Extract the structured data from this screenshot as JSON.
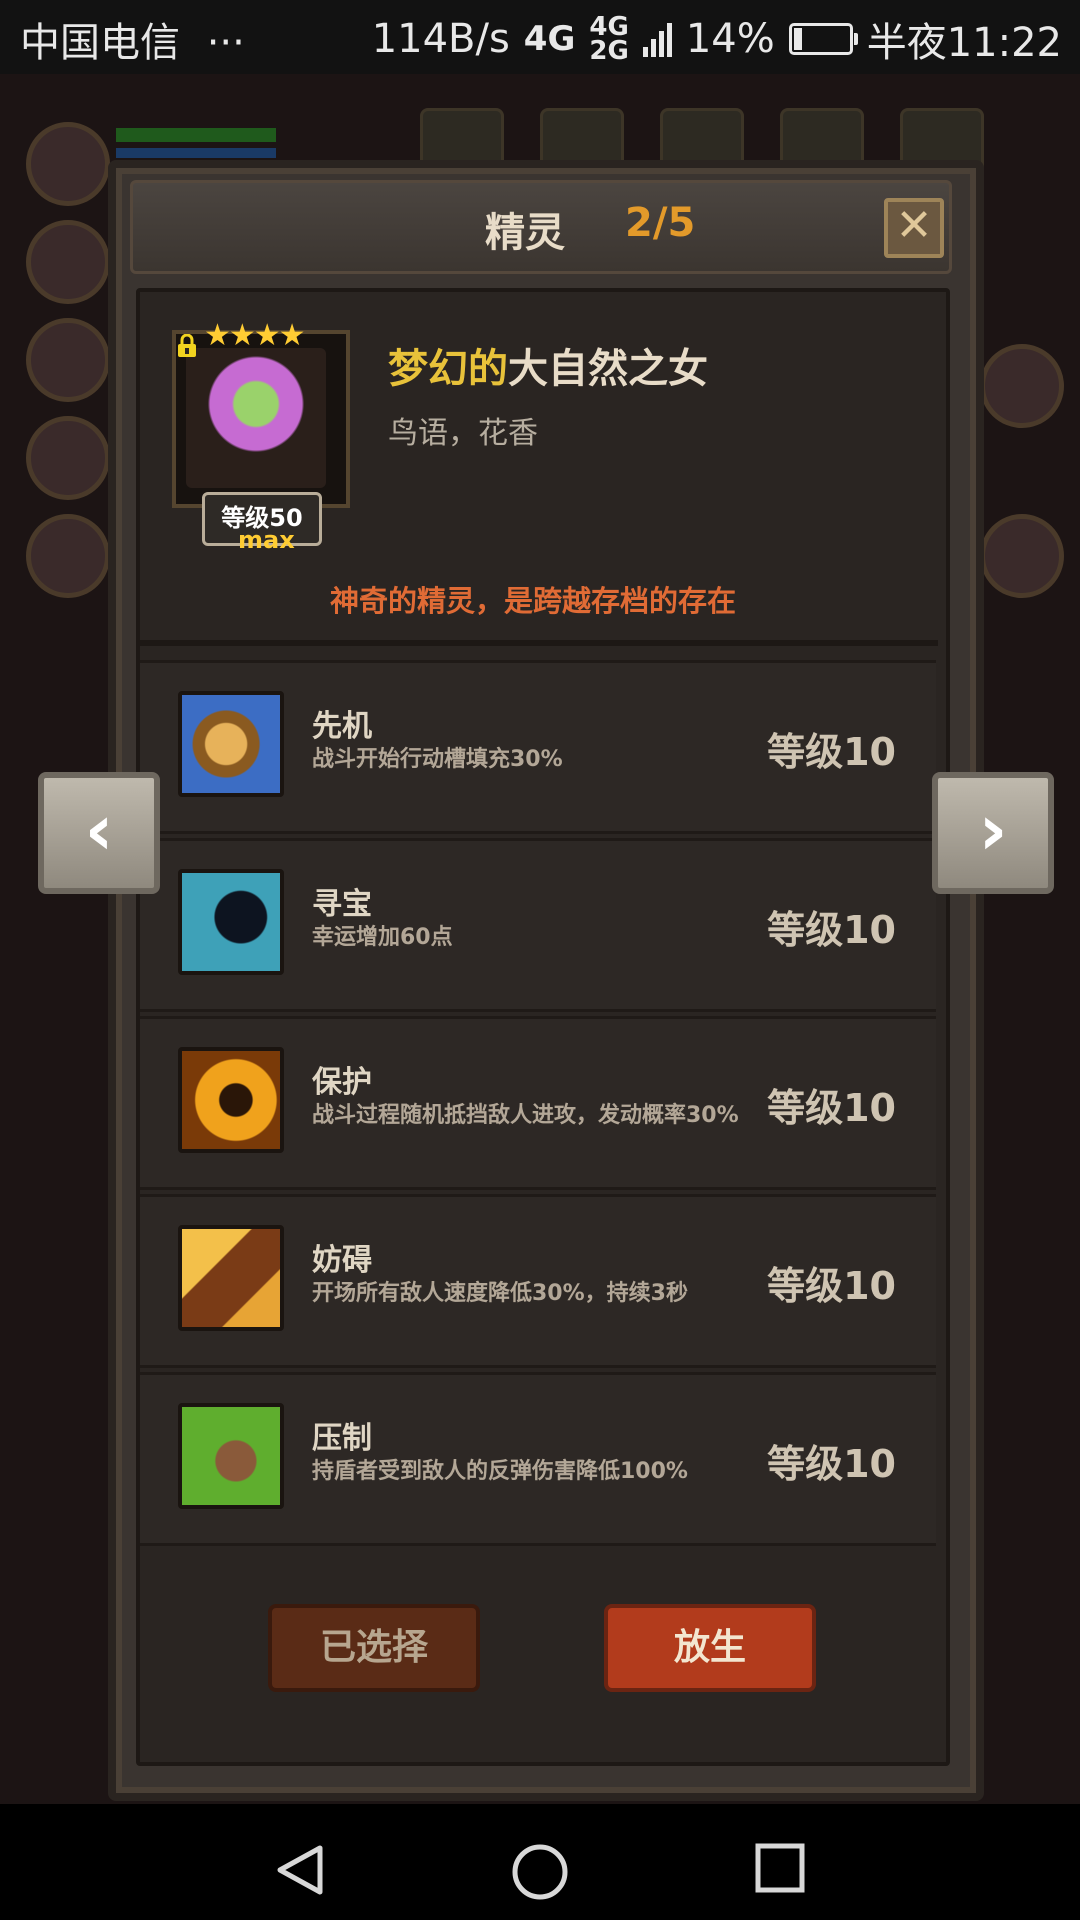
{
  "status_bar": {
    "carrier": "中国电信",
    "dots": "···",
    "speed": "114B/s",
    "network": "4G",
    "network_small_top": "4G",
    "network_small_bottom": "2G",
    "battery": "14%",
    "battery_level": 0.14,
    "time": "半夜11:22"
  },
  "dialog": {
    "title": "精灵",
    "count": "2/5",
    "close_label": "✕"
  },
  "hero": {
    "stars": "★★★★",
    "name_quality": "梦幻的",
    "name": "大自然之女",
    "subtitle": "鸟语，花香",
    "level_label": "等级50",
    "max_label": "max",
    "description": "神奇的精灵，是跨越存档的存在"
  },
  "skills": [
    {
      "name": "先机",
      "desc": "战斗开始行动槽填充30%",
      "level": "等级10",
      "icon": "leopard-icon"
    },
    {
      "name": "寻宝",
      "desc": "幸运增加60点",
      "level": "等级10",
      "icon": "silhouette-icon"
    },
    {
      "name": "保护",
      "desc": "战斗过程随机抵挡敌人进攻，发动概率30%",
      "level": "等级10",
      "icon": "fairy-icon"
    },
    {
      "name": "妨碍",
      "desc": "开场所有敌人速度降低30%，持续3秒",
      "level": "等级10",
      "icon": "chain-boot-icon"
    },
    {
      "name": "压制",
      "desc": "持盾者受到敌人的反弹伤害降低100%",
      "level": "等级10",
      "icon": "claw-icon"
    }
  ],
  "buttons": {
    "selected": "已选择",
    "release": "放生",
    "prev": "‹",
    "next": "›"
  },
  "colors": {
    "accent_orange": "#e39a2a",
    "quality_gold": "#e8c23a",
    "desc_orange": "#e06b35",
    "release_red": "#b23b1c"
  }
}
